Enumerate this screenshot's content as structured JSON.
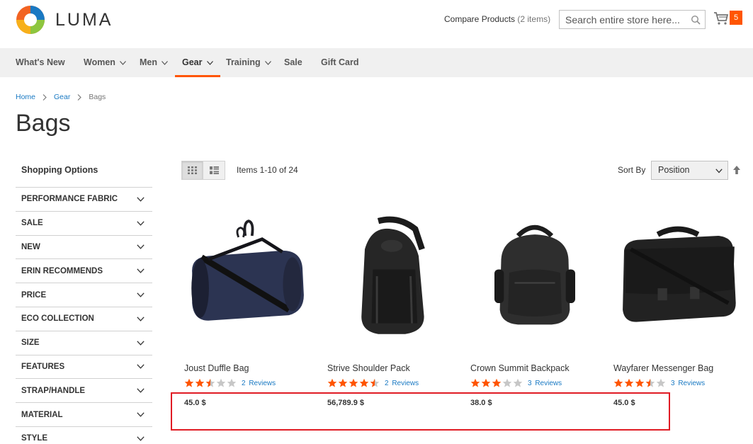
{
  "header": {
    "logo_text": "LUMA",
    "compare_label": "Compare Products",
    "compare_count": "(2 items)",
    "search_placeholder": "Search entire store here...",
    "cart_count": "5"
  },
  "nav": [
    {
      "label": "What's New",
      "has_dropdown": false
    },
    {
      "label": "Women",
      "has_dropdown": true
    },
    {
      "label": "Men",
      "has_dropdown": true
    },
    {
      "label": "Gear",
      "has_dropdown": true,
      "active": true
    },
    {
      "label": "Training",
      "has_dropdown": true
    },
    {
      "label": "Sale",
      "has_dropdown": false
    },
    {
      "label": "Gift Card",
      "has_dropdown": false
    }
  ],
  "breadcrumb": [
    {
      "label": "Home"
    },
    {
      "label": "Gear"
    },
    {
      "label": "Bags"
    }
  ],
  "page_title": "Bags",
  "sidebar": {
    "title": "Shopping Options",
    "filters": [
      "PERFORMANCE FABRIC",
      "SALE",
      "NEW",
      "ERIN RECOMMENDS",
      "PRICE",
      "ECO COLLECTION",
      "SIZE",
      "FEATURES",
      "STRAP/HANDLE",
      "MATERIAL",
      "STYLE"
    ]
  },
  "toolbar": {
    "items_count": "Items 1-10 of 24",
    "sort_label": "Sort By",
    "sort_value": "Position"
  },
  "colors": {
    "accent": "#ff5501",
    "link": "#1979c3",
    "highlight_box": "#e01b24"
  },
  "products": [
    {
      "name": "Joust Duffle Bag",
      "rating": 2.5,
      "reviews": "2  Reviews",
      "price": "45.0 $",
      "icon": "duffle-bag"
    },
    {
      "name": "Strive Shoulder Pack",
      "rating": 4.5,
      "reviews": "2  Reviews",
      "price": "56,789.9 $",
      "icon": "shoulder-pack"
    },
    {
      "name": "Crown Summit Backpack",
      "rating": 3,
      "reviews": "3  Reviews",
      "price": "38.0 $",
      "icon": "backpack"
    },
    {
      "name": "Wayfarer Messenger Bag",
      "rating": 3.5,
      "reviews": "3  Reviews",
      "price": "45.0 $",
      "icon": "messenger-bag"
    }
  ]
}
